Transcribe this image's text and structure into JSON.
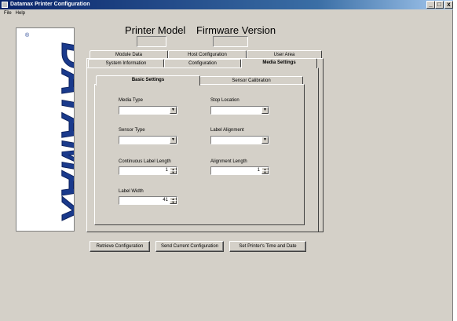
{
  "window": {
    "title": "Datamax Printer Configuration",
    "controls": {
      "minimize": "_",
      "maximize": "□",
      "close": "x"
    }
  },
  "menu": {
    "items": [
      "File",
      "Help"
    ]
  },
  "logo": {
    "text": "DATAMAX",
    "registered": "®",
    "color": "#1a3a8c"
  },
  "header": {
    "printer_model_label": "Printer Model",
    "printer_model_value": "",
    "firmware_version_label": "Firmware Version",
    "firmware_version_value": ""
  },
  "tabs": {
    "back_row": [
      "Module Data",
      "Host Configuration",
      "User Area"
    ],
    "front_row": [
      "System Information",
      "Configuration",
      "Media Settings"
    ],
    "active": "Media Settings"
  },
  "subtabs": {
    "items": [
      "Basic Settings",
      "Sensor Calibration"
    ],
    "active": "Basic Settings"
  },
  "basic_settings": {
    "media_type": {
      "label": "Media Type",
      "value": ""
    },
    "stop_location": {
      "label": "Stop Location",
      "value": ""
    },
    "sensor_type": {
      "label": "Sensor Type",
      "value": ""
    },
    "label_alignment": {
      "label": "Label Alignment",
      "value": ""
    },
    "continuous_label_length": {
      "label": "Continuous Label Length",
      "value": "1"
    },
    "alignment_length": {
      "label": "Alignment Length",
      "value": "1"
    },
    "label_width": {
      "label": "Label Width",
      "value": "41"
    }
  },
  "buttons": {
    "retrieve": "Retrieve Configuration",
    "send": "Send Current Configuration",
    "set_time": "Set Printer's Time and Date"
  }
}
